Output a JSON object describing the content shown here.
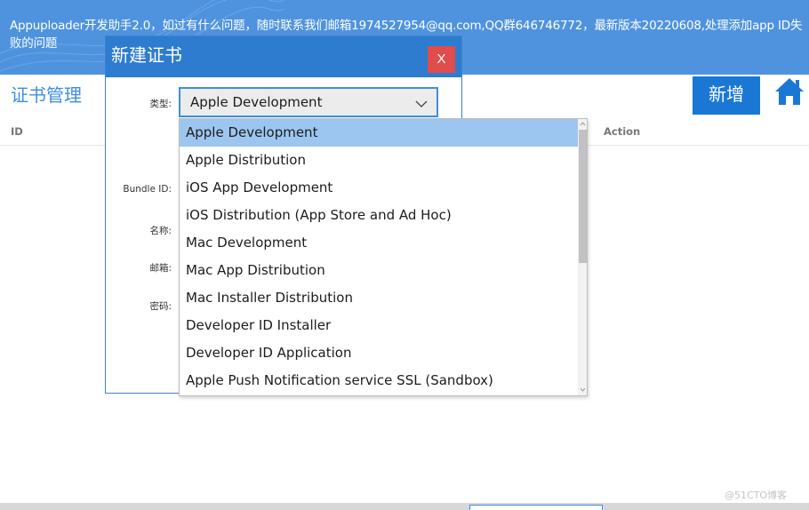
{
  "banner": {
    "notice": "Appuploader开发助手2.0，如过有什么问题，随时联系我们邮箱1974527954@qq.com,QQ群646746772，最新版本20220608,处理添加app ID失败的问题",
    "background": "#4f93df"
  },
  "header": {
    "title": "证书管理",
    "new_button": "新增",
    "home_icon": "home-icon"
  },
  "table": {
    "columns": [
      "ID",
      "Action"
    ]
  },
  "modal": {
    "title": "新建证书",
    "close_label": "X",
    "fields": {
      "type_label": "类型:",
      "bundle_label": "Bundle ID:",
      "name_label": "名称:",
      "email_label": "邮箱:",
      "password_label": "密码:"
    },
    "type_value": "Apple Development"
  },
  "dropdown": {
    "options": [
      "Apple Development",
      "Apple Distribution",
      "iOS App Development",
      "iOS Distribution (App Store and Ad Hoc)",
      "Mac Development",
      "Mac App Distribution",
      "Mac Installer Distribution",
      "Developer ID Installer",
      "Developer ID Application",
      "Apple Push Notification service SSL (Sandbox)"
    ],
    "selected": "Apple Development"
  },
  "watermark": "@51CTO博客",
  "colors": {
    "accent": "#2d7ccf",
    "close": "#e14c4c",
    "highlight": "#9cc6ef"
  }
}
